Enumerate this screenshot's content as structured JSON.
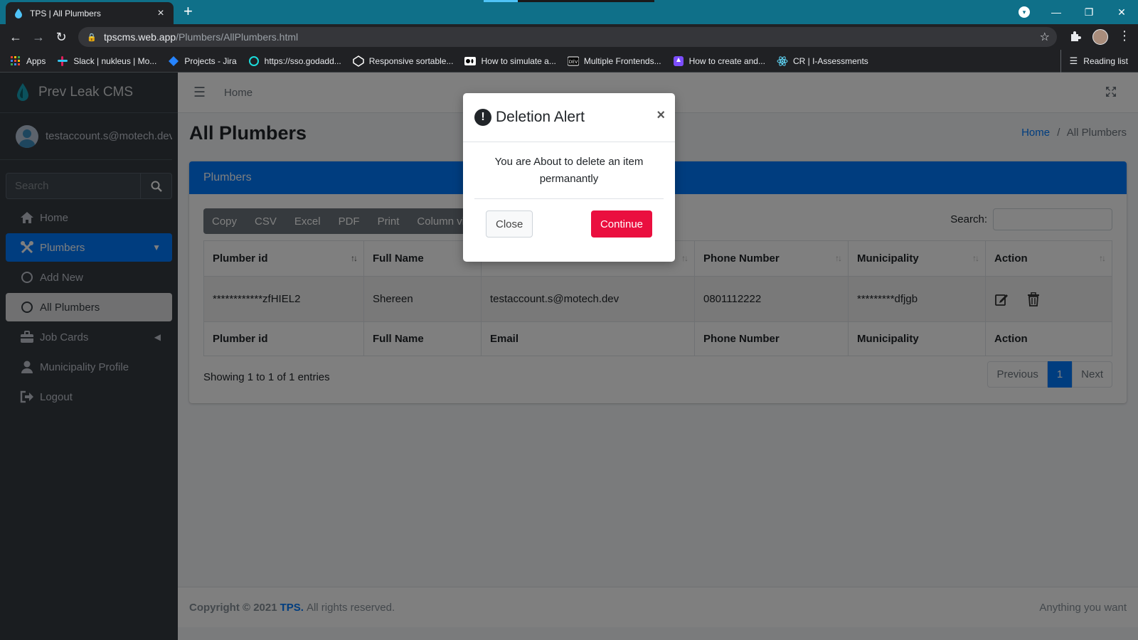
{
  "browser": {
    "tab_title": "TPS | All Plumbers",
    "tab_close": "×",
    "new_tab": "+",
    "url_host": "tpscms.web.app",
    "url_path": "/Plumbers/AllPlumbers.html",
    "bookmarks": [
      {
        "label": "Apps",
        "color": "#ea4335"
      },
      {
        "label": "Slack | nukleus | Mo...",
        "color": "#e01e5a"
      },
      {
        "label": "Projects - Jira",
        "color": "#2684ff"
      },
      {
        "label": "https://sso.godadd...",
        "color": "#1bdbdb"
      },
      {
        "label": "Responsive sortable...",
        "color": "#ffffff"
      },
      {
        "label": "How to simulate a...",
        "color": "#ffffff"
      },
      {
        "label": "Multiple Frontends...",
        "color": "#ffffff"
      },
      {
        "label": "How to create and...",
        "color": "#7c4dff"
      },
      {
        "label": "CR | I-Assessments",
        "color": "#61dafb"
      }
    ],
    "reading_list": "Reading list"
  },
  "sidebar": {
    "brand": "Prev Leak CMS",
    "user": "testaccount.s@motech.dev",
    "search_placeholder": "Search",
    "items": [
      {
        "label": "Home"
      },
      {
        "label": "Plumbers"
      },
      {
        "label": "Add New"
      },
      {
        "label": "All Plumbers"
      },
      {
        "label": "Job Cards"
      },
      {
        "label": "Municipality Profile"
      },
      {
        "label": "Logout"
      }
    ]
  },
  "header": {
    "home": "Home"
  },
  "page": {
    "title": "All Plumbers",
    "breadcrumb_home": "Home",
    "breadcrumb_sep": "/",
    "breadcrumb_current": "All Plumbers"
  },
  "card": {
    "title": "Plumbers",
    "buttons": [
      "Copy",
      "CSV",
      "Excel",
      "PDF",
      "Print",
      "Column visibility"
    ],
    "search_label": "Search:",
    "columns": [
      "Plumber id",
      "Full Name",
      "Email",
      "Phone Number",
      "Municipality",
      "Action"
    ],
    "rows": [
      {
        "id": "************zfHIEL2",
        "name": "Shereen",
        "email": "testaccount.s@motech.dev",
        "phone": "0801112222",
        "municipality": "*********dfjgb"
      }
    ],
    "info": "Showing 1 to 1 of 1 entries",
    "pagination": {
      "prev": "Previous",
      "current": "1",
      "next": "Next"
    }
  },
  "footer": {
    "copyright": "Copyright © 2021 ",
    "brand": "TPS.",
    "rights": " All rights reserved.",
    "right_text": "Anything you want"
  },
  "modal": {
    "title": "Deletion Alert",
    "icon_glyph": "!",
    "close_glyph": "×",
    "body": "You are About to delete an item permanantly",
    "close_label": "Close",
    "continue_label": "Continue",
    "continue_color": "#ea0f3f"
  },
  "colors": {
    "primary": "#007bff",
    "sidebar_bg": "#343a40",
    "tabbar": "#0f7089"
  }
}
